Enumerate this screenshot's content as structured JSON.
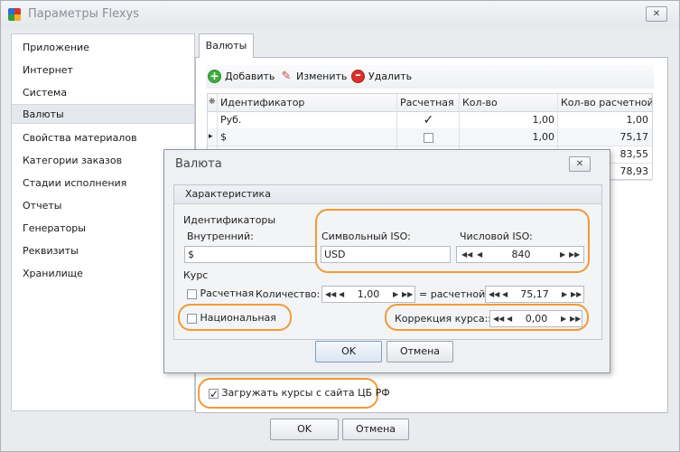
{
  "window": {
    "title": "Параметры Flexys",
    "close_glyph": "✕"
  },
  "sidebar": {
    "items": [
      {
        "label": "Приложение"
      },
      {
        "label": "Интернет"
      },
      {
        "label": "Система"
      },
      {
        "label": "Валюты",
        "selected": true
      },
      {
        "label": "Свойства материалов"
      },
      {
        "label": "Категории заказов"
      },
      {
        "label": "Стадии исполнения"
      },
      {
        "label": "Отчеты"
      },
      {
        "label": "Генераторы"
      },
      {
        "label": "Реквизиты"
      },
      {
        "label": "Хранилище"
      }
    ]
  },
  "tab": {
    "label": "Валюты"
  },
  "toolbar": {
    "add_label": "Добавить",
    "edit_label": "Изменить",
    "delete_label": "Удалить"
  },
  "grid": {
    "columns": [
      "Идентификатор",
      "Расчетная",
      "Кол-во",
      "Кол-во расчетной"
    ],
    "header_glyph": "❋",
    "current_row_glyph": "▸",
    "rows": [
      {
        "id": "Руб.",
        "calc": true,
        "qty": "1,00",
        "qty_calc": "1,00"
      },
      {
        "id": "$",
        "calc": false,
        "qty": "1,00",
        "qty_calc": "75,17",
        "current": true
      },
      {
        "id": "",
        "calc": false,
        "qty": "",
        "qty_calc": "83,55"
      },
      {
        "id": "",
        "calc": false,
        "qty": "",
        "qty_calc": "78,93"
      }
    ]
  },
  "dialog": {
    "title": "Валюта",
    "close_glyph": "✕",
    "group_title": "Характеристика",
    "identifiers_label": "Идентификаторы",
    "internal_label": "Внутренний:",
    "internal_value": "$",
    "iso_symbol_label": "Символьный ISO:",
    "iso_symbol_value": "USD",
    "iso_numeric_label": "Числовой ISO:",
    "iso_numeric_value": "840",
    "rate_label": "Курс",
    "calc_checkbox_label": "Расчетная",
    "quantity_label": "Количество:",
    "quantity_value": "1,00",
    "equals_label": "= расчетной:",
    "calc_value": "75,17",
    "national_label": "Национальная",
    "correction_label": "Коррекция курса::",
    "correction_value": "0,00",
    "ok_label": "OK",
    "cancel_label": "Отмена"
  },
  "load_rates_label": "Загружать курсы с сайта ЦБ РФ",
  "footer": {
    "ok_label": "OK",
    "cancel_label": "Отмена"
  },
  "spin_arrows": {
    "first": "◀◀",
    "prev": "◀",
    "next": "▶",
    "last": "▶▶"
  },
  "colors": {
    "highlight": "#ef9a3a",
    "selected_bg": "#e5e9ee",
    "add_green": "#3fae3f",
    "delete_red": "#d9302b"
  }
}
